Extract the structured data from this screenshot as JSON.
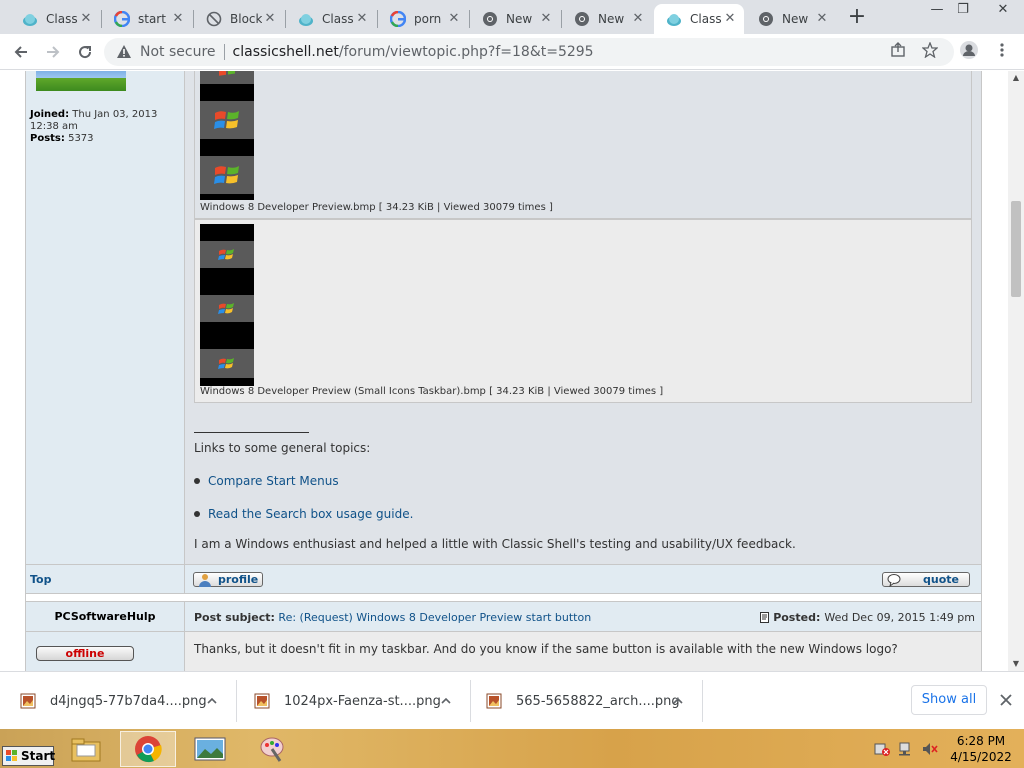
{
  "browser": {
    "tabs": [
      {
        "title": "Class",
        "icon": "shell-icon"
      },
      {
        "title": "start",
        "icon": "google-icon"
      },
      {
        "title": "Block",
        "icon": "block-icon"
      },
      {
        "title": "Class",
        "icon": "shell-icon"
      },
      {
        "title": "porn",
        "icon": "google-icon"
      },
      {
        "title": "New",
        "icon": "chrome-icon"
      },
      {
        "title": "New",
        "icon": "chrome-icon"
      },
      {
        "title": "Class",
        "icon": "shell-icon",
        "active": true
      },
      {
        "title": "New",
        "icon": "chrome-icon"
      }
    ],
    "new_tab_label": "+",
    "window_controls": {
      "minimize": "—",
      "restore": "❐",
      "close": "✕"
    },
    "omnibox": {
      "security": "Not secure",
      "host": "classicshell.net",
      "path": "/forum/viewtopic.php?f=18&t=5295"
    }
  },
  "post1": {
    "profile": {
      "joined_label": "Joined:",
      "joined_value": "Thu Jan 03, 2013 12:38 am",
      "posts_label": "Posts:",
      "posts_value": "5373"
    },
    "attachments": [
      {
        "caption": "Windows 8 Developer Preview.bmp [ 34.23 KiB | Viewed 30079 times ]"
      },
      {
        "caption": "Windows 8 Developer Preview (Small Icons Taskbar).bmp [ 34.23 KiB | Viewed 30079 times ]"
      }
    ],
    "signature": {
      "heading": "Links to some general topics:",
      "links": [
        "Compare Start Menus",
        "Read the Search box usage guide."
      ],
      "footer": "I am a Windows enthusiast and helped a little with Classic Shell's testing and usability/UX feedback."
    },
    "actions": {
      "top": "Top",
      "profile": "profile",
      "quote": "quote"
    }
  },
  "post2": {
    "author": "PCSoftwareHulp",
    "status": "offline",
    "subject_label": "Post subject:",
    "subject": "Re: (Request) Windows 8 Developer Preview start button",
    "posted_label": "Posted:",
    "posted_value": "Wed Dec 09, 2015 1:49 pm",
    "text": "Thanks, but it doesn't fit in my taskbar. And do you know if the same button is available with the new Windows logo?"
  },
  "downloads": {
    "items": [
      {
        "name": "d4jngq5-77b7da4....png"
      },
      {
        "name": "1024px-Faenza-st....png"
      },
      {
        "name": "565-5658822_arch....png"
      }
    ],
    "show_all": "Show all"
  },
  "taskbar": {
    "start_label": "Start",
    "time": "6:28 PM",
    "date": "4/15/2022"
  },
  "colors": {
    "link": "#105289",
    "post_bg": "#dfe3e8",
    "profile_bg": "#e1ebf2",
    "offline": "#cc0000"
  }
}
